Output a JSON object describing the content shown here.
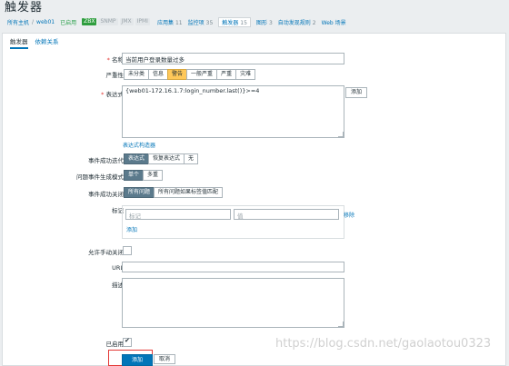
{
  "page_title": "触发器",
  "nav": {
    "all_hosts": "所有主机",
    "host": "web01",
    "enabled": "已启用",
    "badges": [
      "ZBX",
      "SNMP",
      "JMX",
      "IPMI"
    ],
    "items": [
      {
        "label": "应用集",
        "count": "11"
      },
      {
        "label": "监控项",
        "count": "35"
      },
      {
        "label": "触发器",
        "count": "15"
      },
      {
        "label": "图形",
        "count": "3"
      },
      {
        "label": "自动发现规则",
        "count": "2"
      },
      {
        "label": "Web 场景",
        "count": ""
      }
    ]
  },
  "tabs": [
    "触发器",
    "依赖关系"
  ],
  "form": {
    "name_label": "名称",
    "name_value": "当前用户登录数量过多",
    "severity_label": "严重性",
    "severity_options": [
      "未分类",
      "信息",
      "警告",
      "一般严重",
      "严重",
      "灾难"
    ],
    "severity_selected": "警告",
    "expression_label": "表达式",
    "expression_value": "{web01-172.16.1.7:login_number.last()}>=4",
    "add_button": "添加",
    "expression_builder": "表达式构造器",
    "ok_event_label": "事件成功迭代",
    "ok_event_options": [
      "表达式",
      "恢复表达式",
      "无"
    ],
    "ok_event_selected": "表达式",
    "problem_mode_label": "问题事件生成模式",
    "problem_mode_options": [
      "单个",
      "多重"
    ],
    "problem_mode_selected": "单个",
    "ok_close_label": "事件成功关闭",
    "ok_close_options": [
      "所有问题",
      "所有问题如果标签值匹配"
    ],
    "ok_close_selected": "所有问题",
    "tags_label": "标记",
    "tag_placeholder": "标记",
    "value_placeholder": "值",
    "remove_link": "移除",
    "add_link": "添加",
    "manual_close_label": "允许手动关闭",
    "url_label": "URL",
    "description_label": "描述",
    "enabled_label": "已启用",
    "submit_button": "添加",
    "cancel_button": "取消"
  },
  "watermark": "https://blog.csdn.net/gaolaotou0323"
}
